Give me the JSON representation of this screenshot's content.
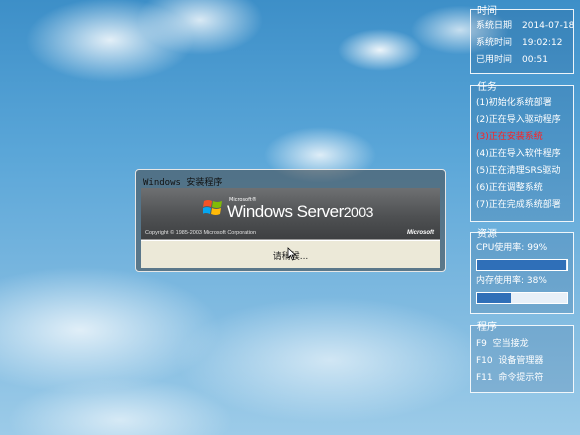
{
  "time_panel": {
    "title": "时间",
    "rows": [
      {
        "label": "系统日期",
        "value": "2014-07-18"
      },
      {
        "label": "系统时间",
        "value": "19:02:12"
      },
      {
        "label": "已用时间",
        "value": "00:51"
      }
    ]
  },
  "task_panel": {
    "title": "任务",
    "items": [
      "(1)初始化系统部署",
      "(2)正在导入驱动程序",
      "(3)正在安装系统",
      "(4)正在导入软件程序",
      "(5)正在清理SRS驱动",
      "(6)正在调整系统",
      "(7)正在完成系统部署"
    ],
    "active_index": 2,
    "active_color": "#ff2020"
  },
  "resource_panel": {
    "title": "资源",
    "cpu_label": "CPU使用率:",
    "cpu_value": "99%",
    "cpu_fraction": 0.99,
    "mem_label": "内存使用率:",
    "mem_value": "38%",
    "mem_fraction": 0.38
  },
  "program_panel": {
    "title": "程序",
    "items": [
      {
        "key": "F9",
        "label": "空当接龙"
      },
      {
        "key": "F10",
        "label": "设备管理器"
      },
      {
        "key": "F11",
        "label": "命令提示符"
      }
    ]
  },
  "dialog": {
    "title": "Windows 安装程序",
    "ms_small": "Microsoft®",
    "product_name": "Windows Server",
    "product_year": "2003",
    "copyright": "Copyright © 1985-2003  Microsoft Corporation",
    "ms_logo": "Microsoft",
    "wait_text": "请稍候..."
  },
  "colors": {
    "bar_fill": "#2f6fb8",
    "panel_border": "#ffffff"
  }
}
